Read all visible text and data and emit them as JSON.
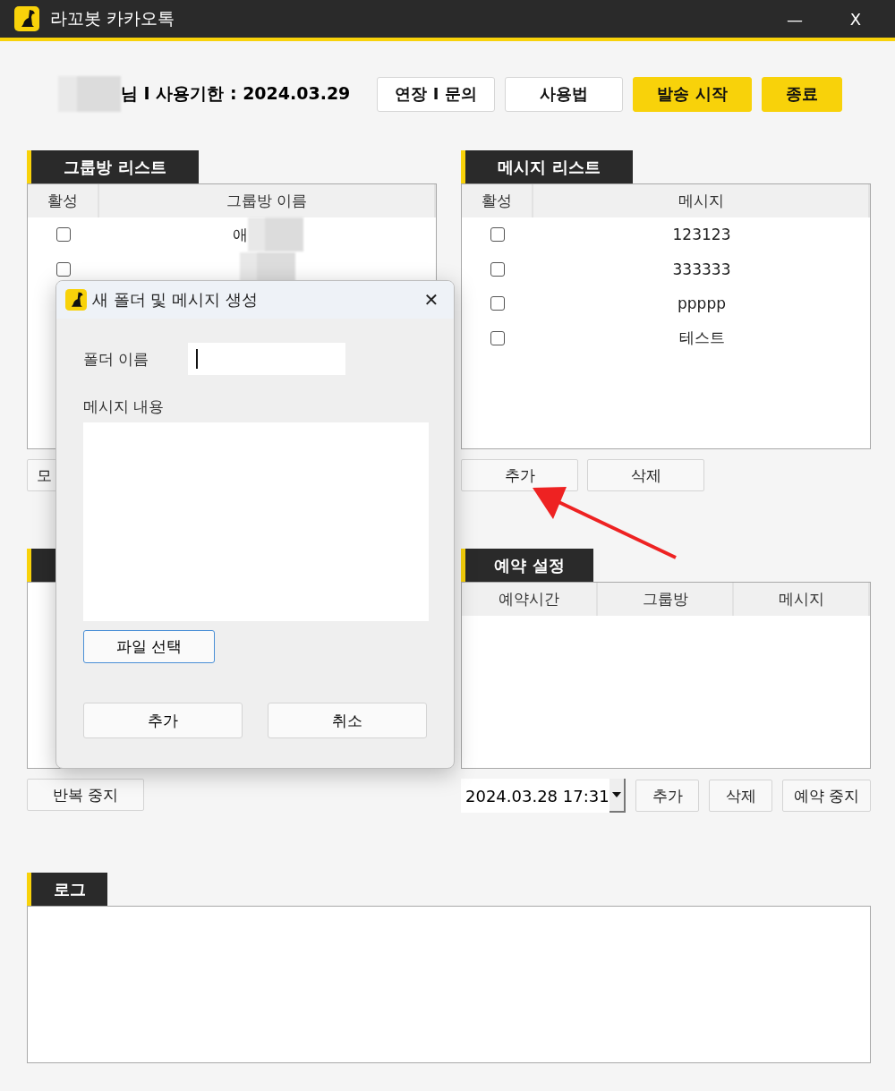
{
  "window": {
    "title": "라꼬봇 카카오톡",
    "controls": [
      "—",
      "X"
    ]
  },
  "header": {
    "user_redacted": true,
    "user_suffix": "님 I 사용기한 : 2024.03.29",
    "buttons": [
      {
        "label": "연장 I 문의",
        "kind": "plain"
      },
      {
        "label": "사용법",
        "kind": "plain"
      },
      {
        "label": "발송 시작",
        "kind": "primary"
      },
      {
        "label": "종료",
        "kind": "primary"
      }
    ]
  },
  "group_panel": {
    "title": "그룹방 리스트",
    "columns": [
      "활성",
      "그룹방 이름"
    ],
    "rows": [
      {
        "checked": false,
        "name": "애",
        "redacted": true
      },
      {
        "checked": false,
        "redacted": true
      }
    ],
    "buttons": [
      "모"
    ]
  },
  "message_panel": {
    "title": "메시지 리스트",
    "columns": [
      "활성",
      "메시지"
    ],
    "rows": [
      {
        "checked": false,
        "text": "123123"
      },
      {
        "checked": false,
        "text": "333333"
      },
      {
        "checked": false,
        "text": "ppppp"
      },
      {
        "checked": false,
        "text": "테스트"
      }
    ],
    "buttons": [
      "추가",
      "삭제"
    ]
  },
  "repeat_panel": {
    "buttons": [
      "반복 중지"
    ]
  },
  "reservation_panel": {
    "title": "예약 설정",
    "columns": [
      "예약시간",
      "그룹방",
      "메시지"
    ],
    "datetime": "2024.03.28 17:31",
    "buttons": [
      "추가",
      "삭제",
      "예약 중지"
    ]
  },
  "log_panel": {
    "title": "로그"
  },
  "annotation": {
    "kind": "arrow"
  },
  "dialog": {
    "title": "새 폴더 및 메시지 생성",
    "close": "✕",
    "folder_label": "폴더 이름",
    "message_label": "메시지 내용",
    "file_button": "파일 선택",
    "buttons": [
      "추가",
      "취소"
    ]
  }
}
